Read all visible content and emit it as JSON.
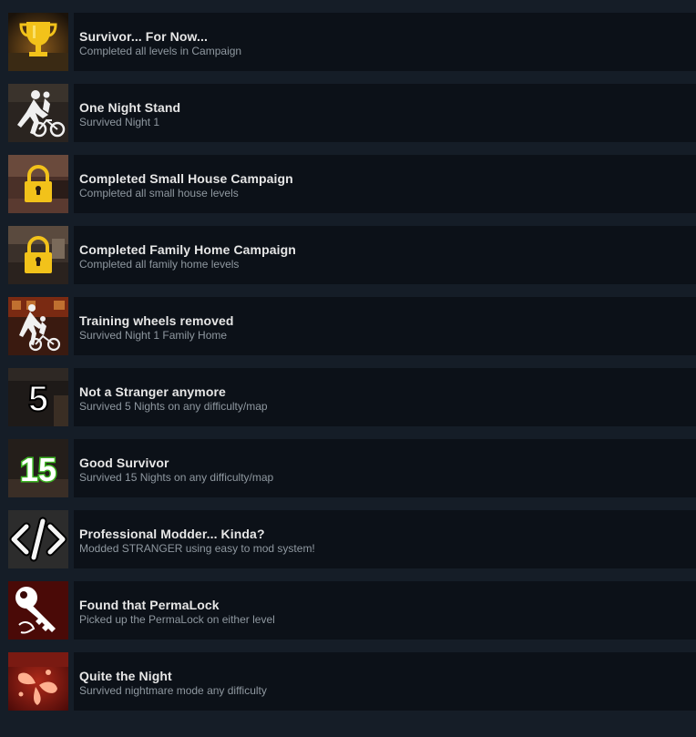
{
  "achievements": [
    {
      "title": "Survivor... For Now...",
      "description": "Completed all levels in Campaign",
      "icon": "trophy-icon"
    },
    {
      "title": "One Night Stand",
      "description": "Survived Night 1",
      "icon": "bicycle-figure-icon"
    },
    {
      "title": "Completed Small House Campaign",
      "description": "Completed all small house levels",
      "icon": "padlock-icon"
    },
    {
      "title": "Completed Family Home Campaign",
      "description": "Completed all family home levels",
      "icon": "padlock-icon"
    },
    {
      "title": "Training wheels removed",
      "description": "Survived Night 1 Family Home",
      "icon": "bicycle-figure-icon"
    },
    {
      "title": "Not a Stranger anymore",
      "description": "Survived 5 Nights on any difficulty/map",
      "icon": "number-5-icon",
      "icon_text": "5"
    },
    {
      "title": "Good Survivor",
      "description": "Survived 15 Nights on any difficulty/map",
      "icon": "number-15-icon",
      "icon_text": "15"
    },
    {
      "title": "Professional Modder... Kinda?",
      "description": "Modded STRANGER using easy to mod system!",
      "icon": "code-brackets-icon"
    },
    {
      "title": "Found that PermaLock",
      "description": "Picked up the PermaLock on either level",
      "icon": "key-icon"
    },
    {
      "title": "Quite the Night",
      "description": "Survived nightmare mode any difficulty",
      "icon": "blood-splatter-icon"
    }
  ],
  "colors": {
    "page_bg": "#151d27",
    "row_bg": "#0c1118",
    "title": "#e6e6e6",
    "description": "#8f98a0",
    "gold": "#f2c21a",
    "green": "#3bb321"
  }
}
